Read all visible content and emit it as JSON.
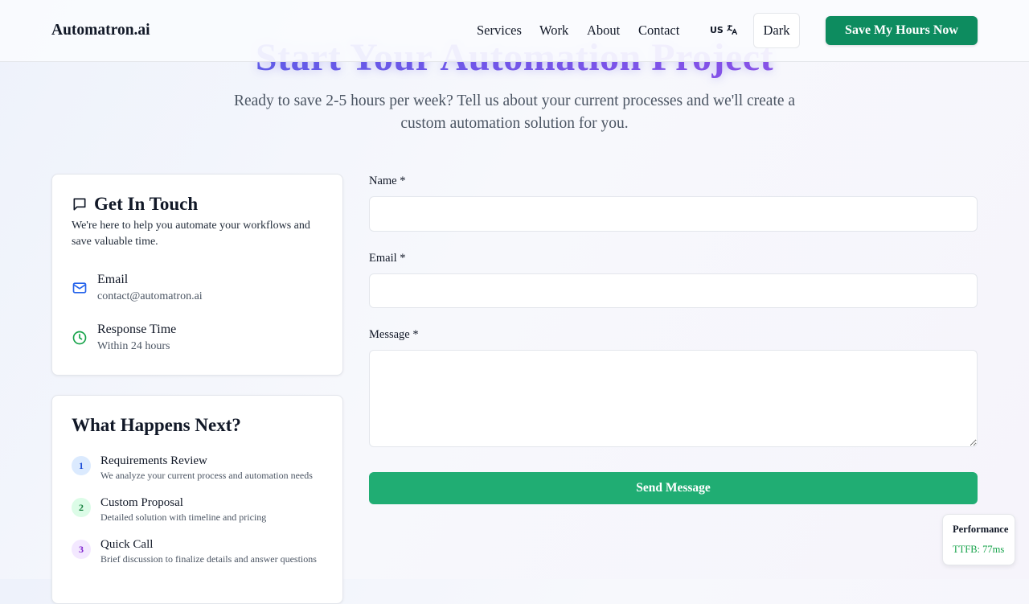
{
  "header": {
    "logo": "Automatron.ai",
    "nav": [
      "Services",
      "Work",
      "About",
      "Contact"
    ],
    "lang": "US",
    "theme_toggle": "Dark",
    "cta": "Save My Hours Now"
  },
  "hero": {
    "title": "Start Your Automation Project",
    "subtitle": "Ready to save 2-5 hours per week? Tell us about your current processes and we'll create a custom automation solution for you."
  },
  "contact_card": {
    "title": "Get In Touch",
    "description": "We're here to help you automate your workflows and save valuable time.",
    "email_label": "Email",
    "email_value": "contact@automatron.ai",
    "response_label": "Response Time",
    "response_value": "Within 24 hours"
  },
  "next_card": {
    "title": "What Happens Next?",
    "steps": [
      {
        "num": "1",
        "title": "Requirements Review",
        "desc": "We analyze your current process and automation needs"
      },
      {
        "num": "2",
        "title": "Custom Proposal",
        "desc": "Detailed solution with timeline and pricing"
      },
      {
        "num": "3",
        "title": "Quick Call",
        "desc": "Brief discussion to finalize details and answer questions"
      }
    ]
  },
  "form": {
    "name_label": "Name *",
    "name_value": "",
    "email_label": "Email *",
    "email_value": "",
    "message_label": "Message *",
    "message_value": "",
    "submit": "Send Message"
  },
  "perf": {
    "title": "Performance",
    "value": "TTFB: 77ms"
  },
  "colors": {
    "accent_green": "#0d8c5f",
    "send_green": "#20ad73",
    "title_gradient_start": "#4f62e6",
    "title_gradient_end": "#9b4de4"
  }
}
